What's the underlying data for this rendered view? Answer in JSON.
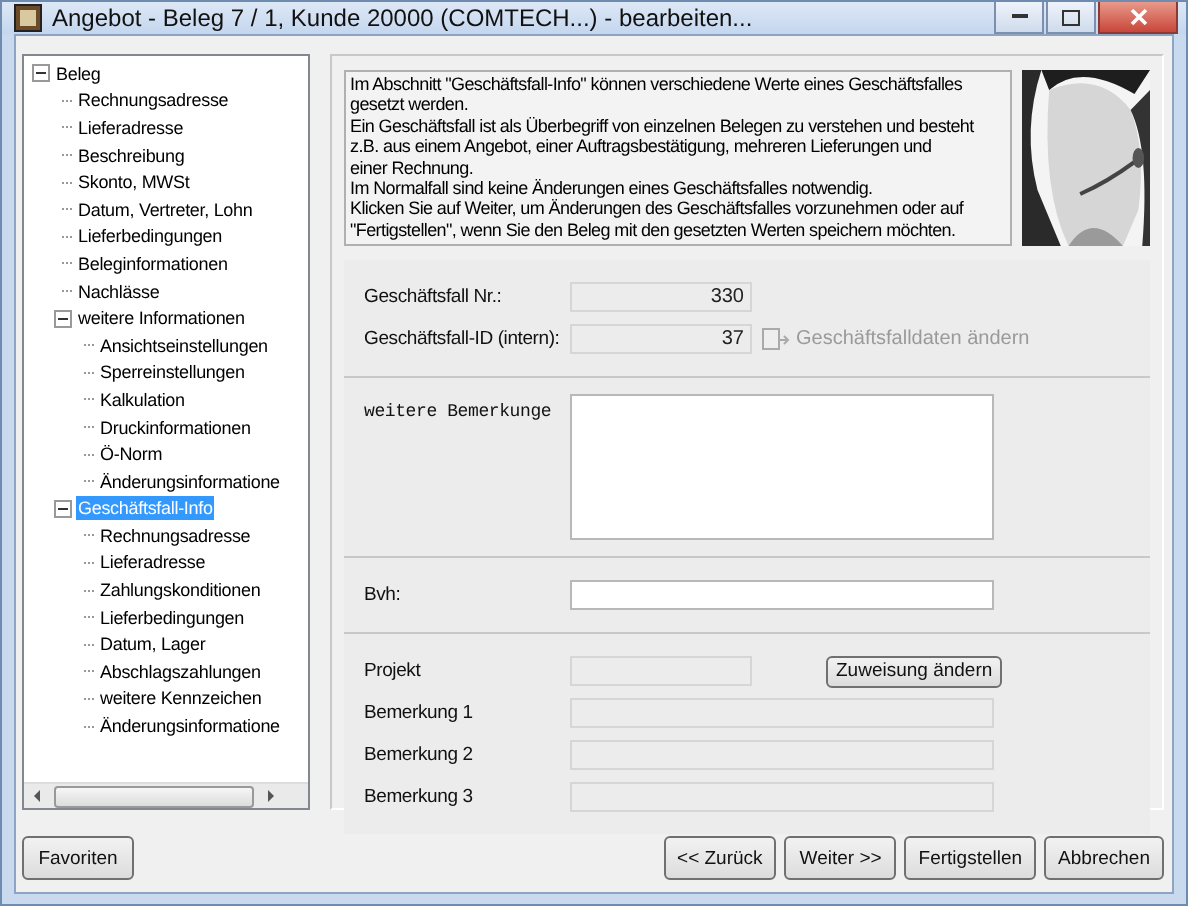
{
  "window": {
    "title": "Angebot - Beleg 7 / 1, Kunde 20000 (COMTECH...)  - bearbeiten..."
  },
  "tree": [
    {
      "label": "Beleg",
      "selected": false,
      "expanded": true,
      "children": [
        {
          "label": "Rechnungsadresse",
          "selected": false
        },
        {
          "label": "Lieferadresse",
          "selected": false
        },
        {
          "label": "Beschreibung",
          "selected": false
        },
        {
          "label": "Skonto, MWSt",
          "selected": false
        },
        {
          "label": "Datum, Vertreter, Lohn",
          "selected": false
        },
        {
          "label": "Lieferbedingungen",
          "selected": false
        },
        {
          "label": "Beleginformationen",
          "selected": false
        },
        {
          "label": "Nachlässe",
          "selected": false
        },
        {
          "label": "weitere Informationen",
          "selected": false,
          "expanded": true,
          "children": [
            {
              "label": "Ansichtseinstellungen",
              "selected": false
            },
            {
              "label": "Sperreinstellungen",
              "selected": false
            },
            {
              "label": "Kalkulation",
              "selected": false
            },
            {
              "label": "Druckinformationen",
              "selected": false
            },
            {
              "label": "Ö-Norm",
              "selected": false
            },
            {
              "label": "Änderungsinformatione",
              "selected": false
            }
          ]
        },
        {
          "label": "Geschäftsfall-Info",
          "selected": true,
          "expanded": true,
          "children": [
            {
              "label": "Rechnungsadresse",
              "selected": false
            },
            {
              "label": "Lieferadresse",
              "selected": false
            },
            {
              "label": "Zahlungskonditionen",
              "selected": false
            },
            {
              "label": "Lieferbedingungen",
              "selected": false
            },
            {
              "label": "Datum, Lager",
              "selected": false
            },
            {
              "label": "Abschlagszahlungen",
              "selected": false
            },
            {
              "label": "weitere Kennzeichen",
              "selected": false
            },
            {
              "label": "Änderungsinformatione",
              "selected": false
            }
          ]
        }
      ]
    }
  ],
  "info_text": "Im Abschnitt \"Geschäftsfall-Info\" können verschiedene Werte eines Geschäftsfalles\ngesetzt werden.\nEin Geschäftsfall ist als Überbegriff von einzelnen Belegen zu verstehen und besteht\nz.B. aus einem Angebot, einer Auftragsbestätigung, mehreren Lieferungen und\neiner Rechnung.\nIm Normalfall sind keine Änderungen eines Geschäftsfalles notwendig.\nKlicken Sie auf Weiter, um Änderungen des Geschäftsfalles vorzunehmen oder auf\n\"Fertigstellen\", wenn Sie den Beleg mit den gesetzten Werten speichern möchten.",
  "case_fields": [
    {
      "label": "Geschäftsfall Nr.:",
      "value": "330",
      "disabled": true
    },
    {
      "label": "Geschäftsfall-ID (intern):",
      "value": "37",
      "disabled": true
    }
  ],
  "change_case_button": {
    "label": "Geschäftsfalldaten ändern",
    "disabled": true
  },
  "remarks": {
    "label": "weitere Bemerkunge"
  },
  "bvh": {
    "label": "Bvh:",
    "disabled": false
  },
  "project": {
    "label": "Projekt",
    "disabled": true,
    "button": "Zuweisung ändern"
  },
  "notes": [
    {
      "label": "Bemerkung 1",
      "disabled": true
    },
    {
      "label": "Bemerkung 2",
      "disabled": true
    },
    {
      "label": "Bemerkung 3",
      "disabled": true
    }
  ],
  "left_button": "Favoriten",
  "nav_buttons": [
    "<< Zurück",
    "Weiter >>",
    "Fertigstellen",
    "Abbrechen"
  ]
}
